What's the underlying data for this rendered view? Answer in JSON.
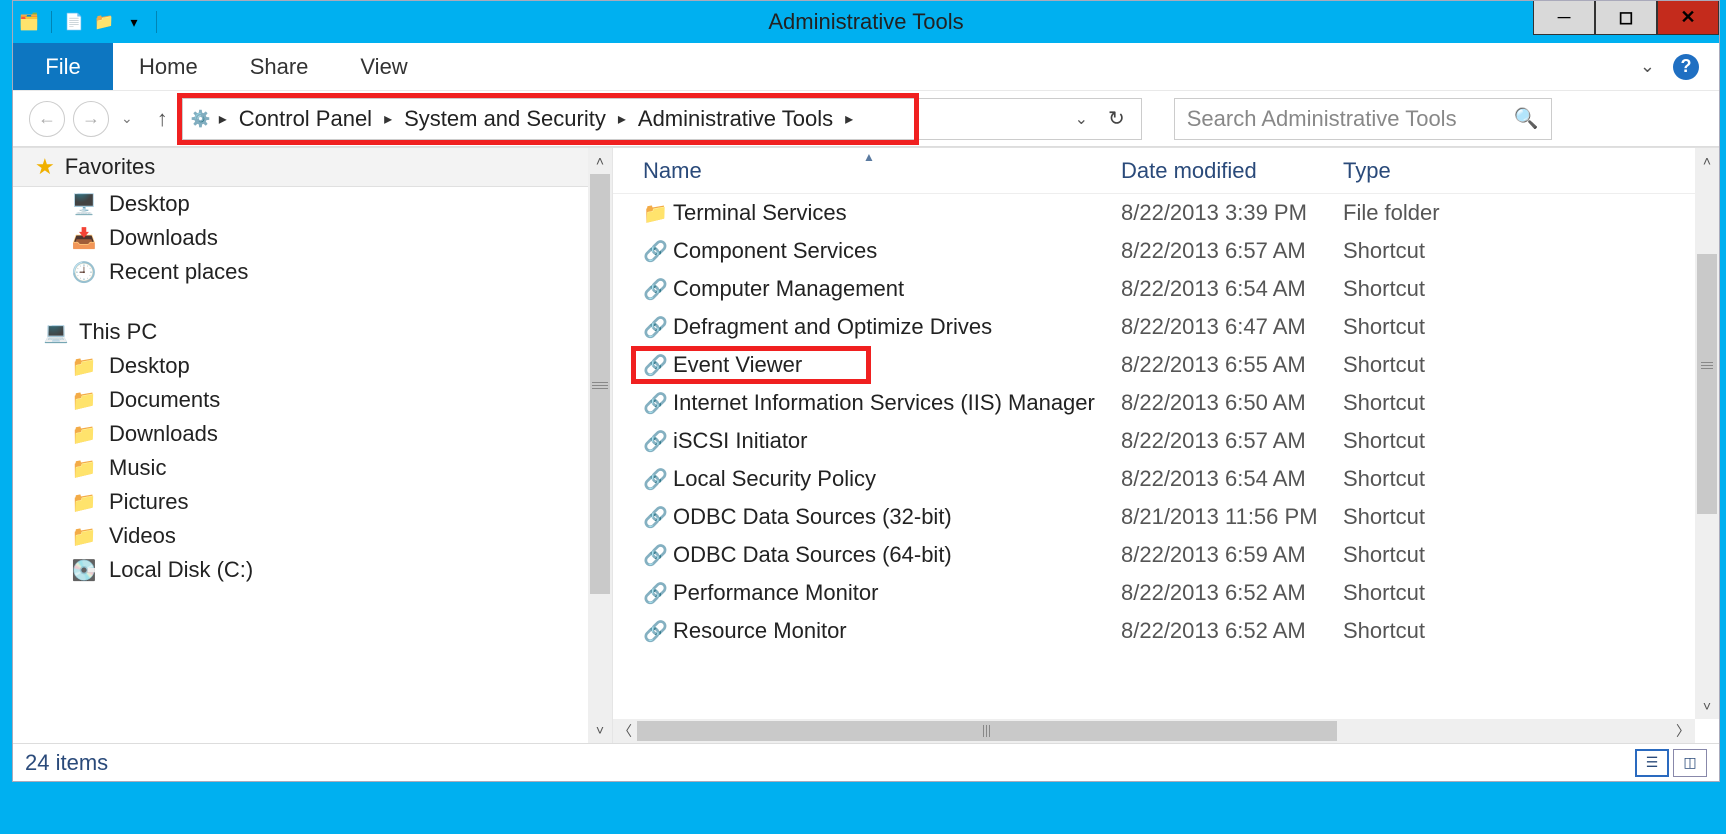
{
  "window": {
    "title": "Administrative Tools",
    "controls": {
      "min": "➖",
      "max": "⬜",
      "close": "✕"
    }
  },
  "ribbon": {
    "file": "File",
    "tabs": [
      "Home",
      "Share",
      "View"
    ]
  },
  "breadcrumb": {
    "segments": [
      "Control Panel",
      "System and Security",
      "Administrative Tools"
    ]
  },
  "search": {
    "placeholder": "Search Administrative Tools"
  },
  "sidebar": {
    "favorites_label": "Favorites",
    "favorites": [
      {
        "icon": "desktop",
        "label": "Desktop"
      },
      {
        "icon": "downloads",
        "label": "Downloads"
      },
      {
        "icon": "recent",
        "label": "Recent places"
      }
    ],
    "thispc_label": "This PC",
    "thispc": [
      {
        "icon": "folder",
        "label": "Desktop"
      },
      {
        "icon": "folder",
        "label": "Documents"
      },
      {
        "icon": "folder",
        "label": "Downloads"
      },
      {
        "icon": "folder",
        "label": "Music"
      },
      {
        "icon": "folder",
        "label": "Pictures"
      },
      {
        "icon": "folder",
        "label": "Videos"
      },
      {
        "icon": "disk",
        "label": "Local Disk (C:)"
      }
    ]
  },
  "columns": {
    "name": "Name",
    "date": "Date modified",
    "type": "Type"
  },
  "items": [
    {
      "icon": "folder",
      "name": "Terminal Services",
      "date": "8/22/2013 3:39 PM",
      "type": "File folder",
      "highlight": false
    },
    {
      "icon": "shortcut",
      "name": "Component Services",
      "date": "8/22/2013 6:57 AM",
      "type": "Shortcut",
      "highlight": false
    },
    {
      "icon": "shortcut",
      "name": "Computer Management",
      "date": "8/22/2013 6:54 AM",
      "type": "Shortcut",
      "highlight": false
    },
    {
      "icon": "shortcut",
      "name": "Defragment and Optimize Drives",
      "date": "8/22/2013 6:47 AM",
      "type": "Shortcut",
      "highlight": false
    },
    {
      "icon": "shortcut",
      "name": "Event Viewer",
      "date": "8/22/2013 6:55 AM",
      "type": "Shortcut",
      "highlight": true
    },
    {
      "icon": "shortcut",
      "name": "Internet Information Services (IIS) Manager",
      "date": "8/22/2013 6:50 AM",
      "type": "Shortcut",
      "highlight": false
    },
    {
      "icon": "shortcut",
      "name": "iSCSI Initiator",
      "date": "8/22/2013 6:57 AM",
      "type": "Shortcut",
      "highlight": false
    },
    {
      "icon": "shortcut",
      "name": "Local Security Policy",
      "date": "8/22/2013 6:54 AM",
      "type": "Shortcut",
      "highlight": false
    },
    {
      "icon": "shortcut",
      "name": "ODBC Data Sources (32-bit)",
      "date": "8/21/2013 11:56 PM",
      "type": "Shortcut",
      "highlight": false
    },
    {
      "icon": "shortcut",
      "name": "ODBC Data Sources (64-bit)",
      "date": "8/22/2013 6:59 AM",
      "type": "Shortcut",
      "highlight": false
    },
    {
      "icon": "shortcut",
      "name": "Performance Monitor",
      "date": "8/22/2013 6:52 AM",
      "type": "Shortcut",
      "highlight": false
    },
    {
      "icon": "shortcut",
      "name": "Resource Monitor",
      "date": "8/22/2013 6:52 AM",
      "type": "Shortcut",
      "highlight": false
    }
  ],
  "status": {
    "count": "24 items"
  }
}
